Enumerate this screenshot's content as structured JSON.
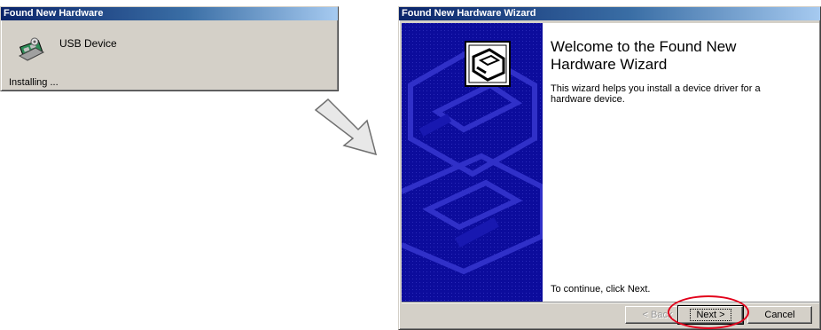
{
  "popup": {
    "title": "Found New Hardware",
    "device_name": "USB Device",
    "status": "Installing ..."
  },
  "wizard": {
    "title": "Found New Hardware Wizard",
    "heading_line1": "Welcome to the Found New",
    "heading_line2": "Hardware Wizard",
    "description": "This wizard helps you install a device driver for a hardware device.",
    "continue_text": "To continue, click Next.",
    "buttons": {
      "back": "< Back",
      "next": "Next >",
      "cancel": "Cancel"
    }
  },
  "colors": {
    "title_bar": "#0a246a",
    "banner": "#0c0c9c",
    "highlight": "#e2001a",
    "face": "#d4d0c8"
  },
  "icons": {
    "popup_icon": "hardware-installing-icon",
    "wizard_icon": "hardware-card-icon",
    "arrow": "arrow-right-down-icon"
  }
}
